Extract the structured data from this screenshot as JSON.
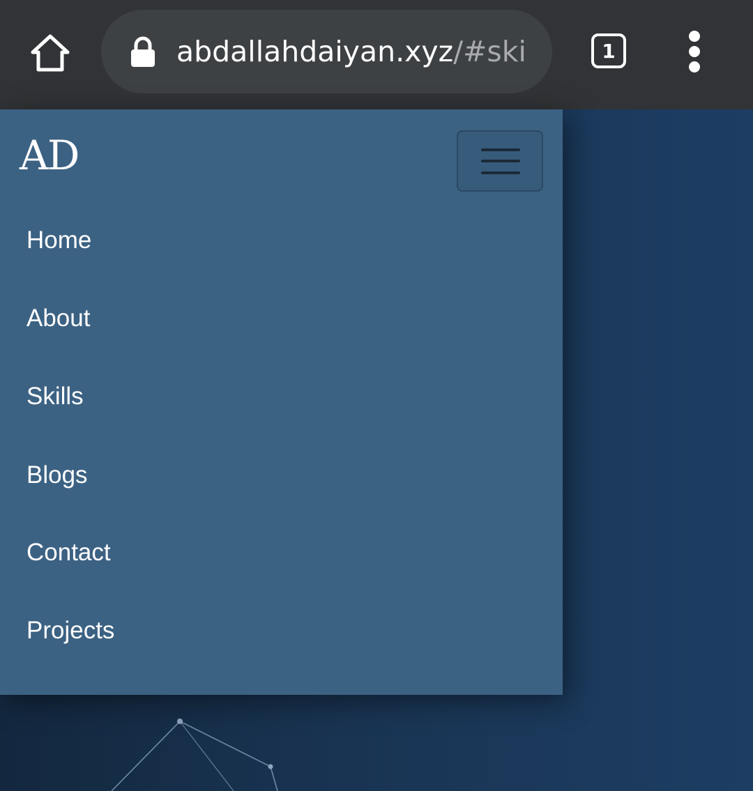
{
  "browser": {
    "url_host": "abdallahdaiyan.xyz",
    "url_rest": "/#ski",
    "tab_count": "1",
    "icons": {
      "home": "home-icon",
      "lock": "lock-icon",
      "tabs": "tab-switcher-icon",
      "menu": "more-vert-icon"
    }
  },
  "navbar": {
    "brand": "AD",
    "toggler_icon": "hamburger-icon",
    "links": [
      {
        "label": "Home"
      },
      {
        "label": "About"
      },
      {
        "label": "Skills"
      },
      {
        "label": "Blogs"
      },
      {
        "label": "Contact"
      },
      {
        "label": "Projects"
      }
    ]
  },
  "colors": {
    "chrome": "#323336",
    "url_pill": "#3e4144",
    "drawer": "#3c6283",
    "page_bg": "#1b3a5c",
    "url_secondary": "#a8aaad"
  }
}
